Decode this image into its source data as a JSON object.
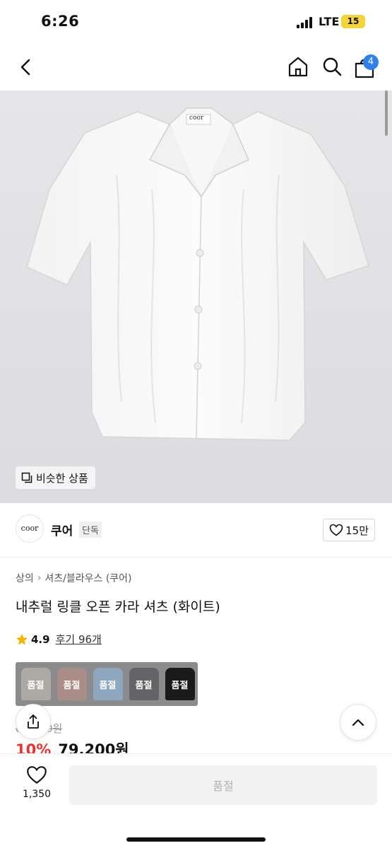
{
  "status_bar": {
    "time": "6:26",
    "network": "LTE",
    "battery": "15"
  },
  "nav": {
    "cart_count": "4"
  },
  "hero": {
    "brand_label": "coor",
    "similar_label": "비슷한 상품"
  },
  "brand": {
    "logo_text": "coor",
    "name": "쿠어",
    "tag": "단독",
    "likes": "15만"
  },
  "breadcrumb": [
    "상의",
    "셔츠/블라우스 (쿠어)"
  ],
  "product": {
    "title": "내추럴 링클 오픈 카라 셔츠 (화이트)",
    "rating": "4.9",
    "review_label": "후기 96개"
  },
  "swatches": [
    {
      "label": "품절",
      "color": "#b8b3ae"
    },
    {
      "label": "품절",
      "color": "#b48d86"
    },
    {
      "label": "품절",
      "color": "#8fb0cf"
    },
    {
      "label": "품절",
      "color": "#5d5d5f"
    },
    {
      "label": "품절",
      "color": "#1a1a1a"
    }
  ],
  "price": {
    "original": "88,000원",
    "discount": "10%",
    "sale": "79,200원"
  },
  "bottom": {
    "wish_count": "1,350",
    "buy_label": "품절"
  },
  "colors": {
    "badge": "#2f80ed",
    "discount": "#ef2f2f",
    "star": "#f5b400"
  }
}
